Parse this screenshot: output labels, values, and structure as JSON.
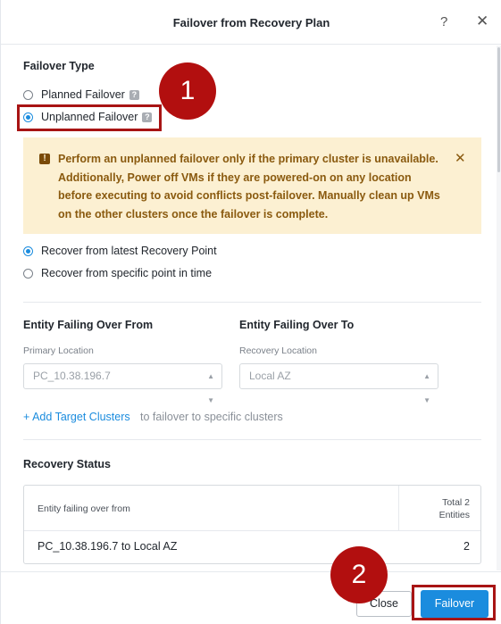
{
  "dialog": {
    "title": "Failover from Recovery Plan",
    "help_glyph": "?",
    "close_glyph": "✕"
  },
  "failover_type": {
    "label": "Failover Type",
    "options": [
      {
        "label": "Planned Failover",
        "checked": false,
        "help": "?"
      },
      {
        "label": "Unplanned Failover",
        "checked": true,
        "help": "?"
      }
    ]
  },
  "warning": {
    "icon": "!",
    "text": "Perform an unplanned failover only if the primary cluster is unavailable. Additionally, Power off VMs if they are powered-on on any location before executing to avoid conflicts post-failover. Manually clean up VMs on the other clusters once the failover is complete.",
    "dismiss_glyph": "✕"
  },
  "recovery_point": {
    "options": [
      {
        "label": "Recover from latest Recovery Point",
        "checked": true
      },
      {
        "label": "Recover from specific point in time",
        "checked": false
      }
    ]
  },
  "entity_from": {
    "heading": "Entity Failing Over From",
    "field_label": "Primary Location",
    "value": "PC_10.38.196.7"
  },
  "entity_to": {
    "heading": "Entity Failing Over To",
    "field_label": "Recovery Location",
    "value": "Local AZ"
  },
  "add_target": {
    "link": "+ Add Target Clusters",
    "suffix": "to failover to specific clusters"
  },
  "recovery_status": {
    "heading": "Recovery Status",
    "col_entity": "Entity failing over from",
    "col_total_line1": "Total 2",
    "col_total_line2": "Entities",
    "rows": [
      {
        "entity": "PC_10.38.196.7 to Local AZ",
        "count": "2"
      }
    ]
  },
  "footer": {
    "close_label": "Close",
    "failover_label": "Failover"
  },
  "annotations": {
    "callout_1": "1",
    "callout_2": "2",
    "color": "#b20f0f"
  },
  "colors": {
    "accent": "#1b8cde",
    "warning_bg": "#fcf0d2",
    "warning_text": "#8a5a0f"
  }
}
